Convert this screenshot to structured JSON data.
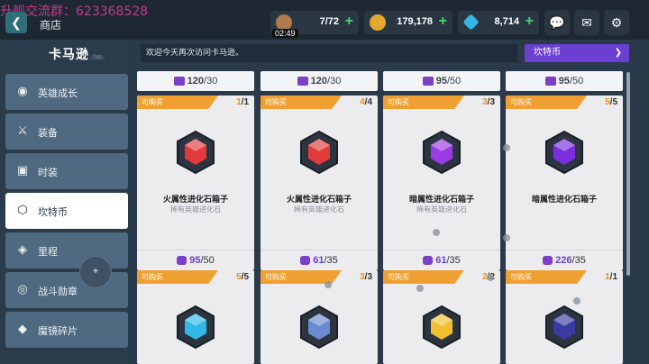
{
  "watermark": "升舰交流群：623368528",
  "header": {
    "title": "商店",
    "timer": "02:49"
  },
  "resources": [
    {
      "value": "7/72",
      "color": "#b07a4e",
      "icon": "coffee-icon"
    },
    {
      "value": "179,178",
      "color": "#e3a92c",
      "icon": "gold-coin-icon"
    },
    {
      "value": "8,714",
      "color": "#35b6e6",
      "icon": "diamond-icon"
    }
  ],
  "sidebar": {
    "brand": "卡马逊",
    "brand_tab": "Tab",
    "items": [
      {
        "label": "英雄成长",
        "icon": "hero-icon"
      },
      {
        "label": "装备",
        "icon": "sword-icon"
      },
      {
        "label": "时装",
        "icon": "shirt-icon"
      },
      {
        "label": "坎特币",
        "icon": "hexagon-coin-icon"
      },
      {
        "label": "里程",
        "icon": "ticket-icon"
      },
      {
        "label": "战斗勋章",
        "icon": "medal-icon"
      },
      {
        "label": "魔镜碎片",
        "icon": "mirror-shard-icon"
      }
    ]
  },
  "welcome": "欢迎今天再次访问卡马逊。",
  "currency_select": "坎特币",
  "top_costs": [
    {
      "have": "120",
      "need": "30"
    },
    {
      "have": "120",
      "need": "30"
    },
    {
      "have": "95",
      "need": "50"
    },
    {
      "have": "95",
      "need": "50"
    }
  ],
  "cards": [
    {
      "tag": "可购买",
      "cur": "1",
      "max": "1",
      "name": "火属性进化石箱子",
      "desc": "稀有英雄进化石",
      "price_a": "95",
      "price_b": "50",
      "color": "#e23a3a"
    },
    {
      "tag": "可购买",
      "cur": "4",
      "max": "4",
      "name": "火属性进化石箱子",
      "desc": "稀有英雄进化石",
      "price_a": "61",
      "price_b": "35",
      "color": "#e23a3a"
    },
    {
      "tag": "可购买",
      "cur": "3",
      "max": "3",
      "name": "暗属性进化石箱子",
      "desc": "稀有英雄进化石",
      "price_a": "61",
      "price_b": "35",
      "color": "#9a3ae2"
    },
    {
      "tag": "可购买",
      "cur": "5",
      "max": "5",
      "name": "暗属性进化石箱子",
      "desc": "",
      "price_a": "226",
      "price_b": "35",
      "color": "#7a2ee0"
    },
    {
      "tag": "可购买",
      "cur": "5",
      "max": "5",
      "name": "",
      "desc": "",
      "price_a": "",
      "price_b": "",
      "color": "#2fb8e8"
    },
    {
      "tag": "可购买",
      "cur": "3",
      "max": "3",
      "name": "",
      "desc": "",
      "price_a": "",
      "price_b": "",
      "color": "#6a8bd1"
    },
    {
      "tag": "可购买",
      "cur": "2",
      "max": "2",
      "name": "",
      "desc": "",
      "price_a": "",
      "price_b": "",
      "color": "#f0c030"
    },
    {
      "tag": "可购买",
      "cur": "1",
      "max": "1",
      "name": "",
      "desc": "",
      "price_a": "",
      "price_b": "",
      "color": "#3a3aa0"
    }
  ]
}
